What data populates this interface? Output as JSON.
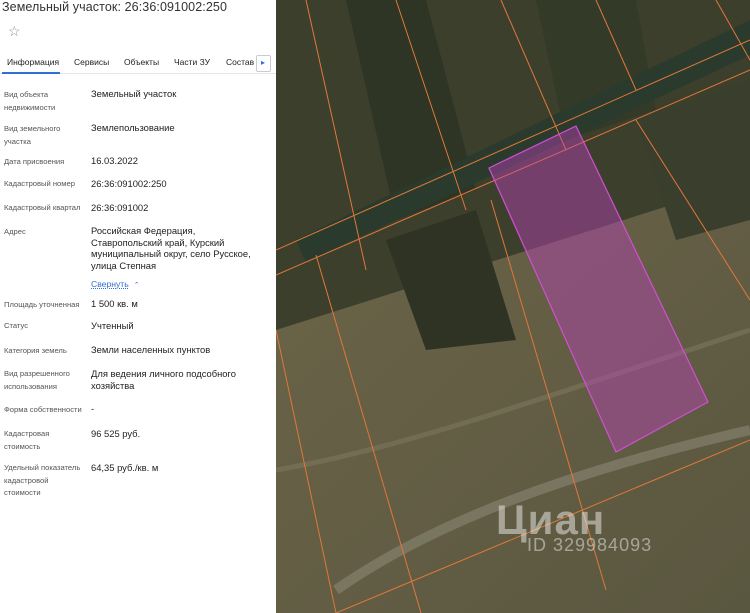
{
  "panel": {
    "title": "Земельный участок: 26:36:091002:250",
    "star_icon": "star-outline-icon",
    "tabs": [
      {
        "label": "Информация",
        "active": true
      },
      {
        "label": "Сервисы",
        "active": false
      },
      {
        "label": "Объекты",
        "active": false
      },
      {
        "label": "Части ЗУ",
        "active": false
      },
      {
        "label": "Состав",
        "active": false
      }
    ],
    "tabs_next_glyph": "▸",
    "fields": {
      "object_type": {
        "label": "Вид объекта недвижимости",
        "value": "Земельный участок"
      },
      "land_type": {
        "label": "Вид земельного участка",
        "value": "Землепользование"
      },
      "assign_date": {
        "label": "Дата присвоения",
        "value": "16.03.2022"
      },
      "cad_number": {
        "label": "Кадастровый номер",
        "value": "26:36:091002:250"
      },
      "cad_quarter": {
        "label": "Кадастровый квартал",
        "value": "26:36:091002"
      },
      "address": {
        "label": "Адрес",
        "value": "Российская Федерация, Ставропольский край, Курский муниципальный округ, село Русское, улица Степная"
      },
      "area": {
        "label": "Площадь уточненная",
        "value": "1 500 кв. м"
      },
      "status": {
        "label": "Статус",
        "value": "Учтенный"
      },
      "category": {
        "label": "Категория земель",
        "value": "Земли населенных пунктов"
      },
      "permitted_use": {
        "label": "Вид разрешенного использования",
        "value": "Для ведения личного подсобного хозяйства"
      },
      "ownership": {
        "label": "Форма собственности",
        "value": "-"
      },
      "cad_value": {
        "label": "Кадастровая стоимость",
        "value": "96 525 руб."
      },
      "specific_value": {
        "label": "Удельный показатель кадастровой стоимости",
        "value": "64,35 руб./кв. м"
      }
    },
    "collapse_label": "Свернуть",
    "collapse_chevron": "⌃"
  },
  "map": {
    "watermark_brand": "Циан",
    "watermark_id": "ID 329984093",
    "parcel_color": "#c040c0",
    "boundary_color": "#e0783a"
  }
}
